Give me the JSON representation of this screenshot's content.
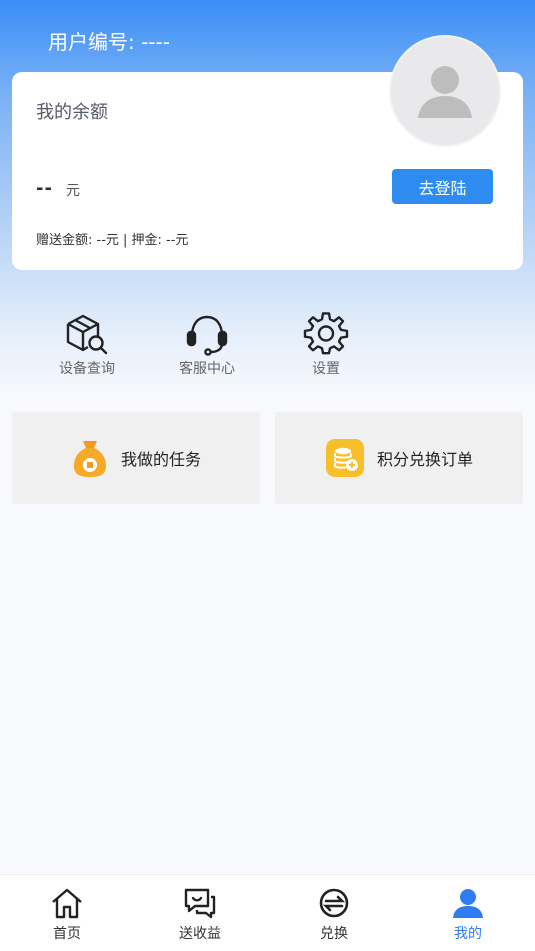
{
  "header": {
    "user_id_label": "用户编号: ----"
  },
  "balance_card": {
    "title": "我的余额",
    "amount": "--",
    "unit": "元",
    "login_button": "去登陆",
    "gift_deposit": "赠送金额: --元 | 押金: --元"
  },
  "quick_actions": [
    {
      "label": "设备查询",
      "icon": "device-search-icon"
    },
    {
      "label": "客服中心",
      "icon": "headset-icon"
    },
    {
      "label": "设置",
      "icon": "gear-icon"
    }
  ],
  "tiles": [
    {
      "label": "我做的任务",
      "icon": "money-bag-icon",
      "color": "#f5a623"
    },
    {
      "label": "积分兑换订单",
      "icon": "coins-icon",
      "color": "#f6c02b"
    }
  ],
  "tabbar": {
    "items": [
      {
        "label": "首页",
        "icon": "home-icon"
      },
      {
        "label": "送收益",
        "icon": "chat-icon"
      },
      {
        "label": "兑换",
        "icon": "exchange-icon"
      },
      {
        "label": "我的",
        "icon": "user-icon"
      }
    ],
    "active_color": "#2e7cf0"
  }
}
